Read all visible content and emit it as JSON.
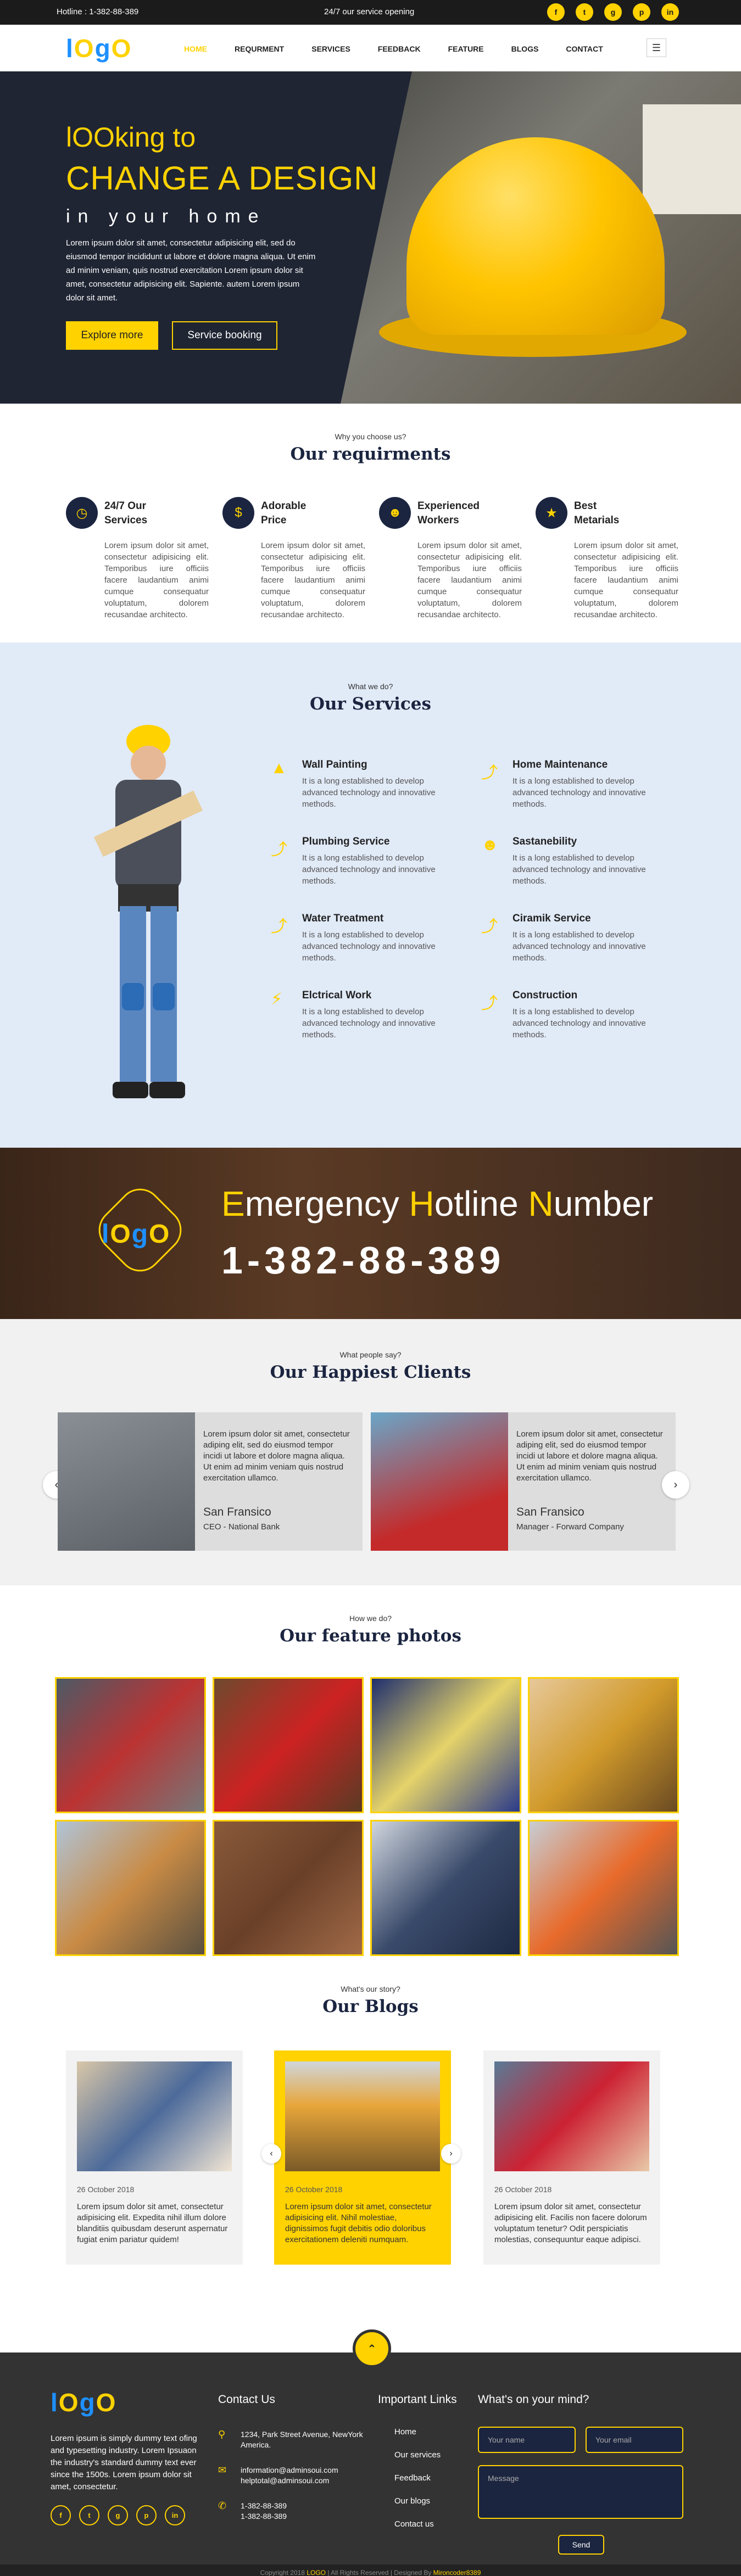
{
  "topbar": {
    "hotline": "Hotline : 1-382-88-389",
    "service": "24/7 our service opening",
    "social": [
      "f",
      "t",
      "g",
      "p",
      "in"
    ],
    "social_icons": [
      "facebook-icon",
      "twitter-icon",
      "instagram-icon",
      "pinterest-icon",
      "linkedin-icon"
    ]
  },
  "brand": {
    "logo_1": "l",
    "logo_2": "O",
    "logo_3": "g",
    "logo_4": "O",
    "blue": "#1e90ff",
    "yellow": "#ffd200"
  },
  "nav": {
    "items": [
      "HOME",
      "REQURMENT",
      "SERVICES",
      "FEEDBACK",
      "FEATURE",
      "BLOGS",
      "CONTACT"
    ],
    "active": "HOME",
    "menu_icon": "hamburger-icon"
  },
  "hero": {
    "line1": "lOOking to",
    "line2": "CHANGE A DESIGN",
    "line3": "in your home",
    "text": "Lorem ipsum dolor sit amet, consectetur adipisicing elit, sed do eiusmod tempor incididunt ut labore et dolore magna aliqua. Ut enim ad minim veniam, quis nostrud exercitation Lorem ipsum dolor sit amet, consectetur adipisicing elit. Sapiente. autem Lorem ipsum dolor sit amet.",
    "btn_explore": "Explore more",
    "btn_booking": "Service booking"
  },
  "requirements": {
    "sub": "Why you choose us?",
    "title": "Our requirments",
    "items": [
      {
        "title": "24/7 Our Services",
        "icon": "clock-icon",
        "text": "Lorem ipsum dolor sit amet, consectetur adipisicing elit. Temporibus iure officiis facere laudantium animi cumque consequatur voluptatum, dolorem recusandae architecto."
      },
      {
        "title": "Adorable Price",
        "icon": "dollar-icon",
        "text": "Lorem ipsum dolor sit amet, consectetur adipisicing elit. Temporibus iure officiis facere laudantium animi cumque consequatur voluptatum, dolorem recusandae architecto."
      },
      {
        "title": "Experienced Workers",
        "icon": "workers-icon",
        "text": "Lorem ipsum dolor sit amet, consectetur adipisicing elit. Temporibus iure officiis facere laudantium animi cumque consequatur voluptatum, dolorem recusandae architecto."
      },
      {
        "title": "Best Metarials",
        "icon": "medal-icon",
        "text": "Lorem ipsum dolor sit amet, consectetur adipisicing elit. Temporibus iure officiis facere laudantium animi cumque consequatur voluptatum, dolorem recusandae architecto."
      }
    ]
  },
  "services": {
    "sub": "What we do?",
    "title": "Our Services",
    "items": [
      {
        "title": "Wall Painting",
        "icon": "paint-roller-icon",
        "text": "It is a long established to develop advanced technology and innovative methods."
      },
      {
        "title": "Home Maintenance",
        "icon": "wrench-icon",
        "text": "It is a long established to develop advanced technology and innovative methods."
      },
      {
        "title": "Plumbing Service",
        "icon": "wrench-icon",
        "text": "It is a long established to develop advanced technology and innovative methods."
      },
      {
        "title": "Sastanebility",
        "icon": "people-icon",
        "text": "It is a long established to develop advanced technology and innovative methods."
      },
      {
        "title": "Water Treatment",
        "icon": "wrench-icon",
        "text": "It is a long established to develop advanced technology and innovative methods."
      },
      {
        "title": "Ciramik Service",
        "icon": "wrench-icon",
        "text": "It is a long established to develop advanced technology and innovative methods."
      },
      {
        "title": "Elctrical Work",
        "icon": "plug-icon",
        "text": "It is a long established to develop advanced technology and innovative methods."
      },
      {
        "title": "Construction",
        "icon": "wrench-icon",
        "text": "It is a long established to develop advanced technology and innovative methods."
      }
    ]
  },
  "hotline": {
    "w1a": "E",
    "w1b": "mergency ",
    "w2a": "H",
    "w2b": "otline ",
    "w3a": "N",
    "w3b": "umber",
    "number": "1-382-88-389"
  },
  "clients": {
    "sub": "What people say?",
    "title": "Our Happiest Clients",
    "items": [
      {
        "quote": "Lorem ipsum dolor sit amet, consectetur adiping elit, sed do eiusmod tempor incidi ut labore et dolore magna aliqua. Ut enim ad minim veniam quis nostrud exercitation ullamco.",
        "name": "San Fransico",
        "role": "CEO - National Bank"
      },
      {
        "quote": "Lorem ipsum dolor sit amet, consectetur adiping elit, sed do eiusmod tempor incidi ut labore et dolore magna aliqua. Ut enim ad minim veniam quis nostrud exercitation ullamco.",
        "name": "San Fransico",
        "role": "Manager - Forward Company"
      }
    ]
  },
  "features": {
    "sub": "How we do?",
    "title": "Our feature photos"
  },
  "blogs": {
    "sub": "What's our story?",
    "title": "Our Blogs",
    "items": [
      {
        "date": "26 October 2018",
        "text": "Lorem ipsum dolor sit amet, consectetur adipisicing elit. Expedita nihil illum dolore blanditiis quibusdam deserunt aspernatur fugiat enim pariatur quidem!"
      },
      {
        "date": "26 October 2018",
        "text": "Lorem ipsum dolor sit amet, consectetur adipisicing elit. Nihil molestiae, dignissimos fugit debitis odio doloribus exercitationem deleniti numquam."
      },
      {
        "date": "26 October 2018",
        "text": "Lorem ipsum dolor sit amet, consectetur adipisicing elit. Facilis non facere dolorum voluptatum tenetur? Odit perspiciatis molestias, consequuntur eaque adipisci."
      }
    ]
  },
  "footer": {
    "about": "Lorem ipsum is simply dummy text ofing and typesetting industry. Lorem Ipsuaon the industry's standard dummy text ever since the 1500s. Lorem ipsum dolor sit amet, consectetur.",
    "social": [
      "f",
      "t",
      "g",
      "p",
      "in"
    ],
    "contact_title": "Contact Us",
    "address": "1234, Park Street Avenue, NewYork America.",
    "email1": "information@adminsoui.com",
    "email2": "helptotal@adminsoui.com",
    "phone1": "1-382-88-389",
    "phone2": "1-382-88-389",
    "links_title": "Important Links",
    "links": [
      "Home",
      "Our services",
      "Feedback",
      "Our blogs",
      "Contact us"
    ],
    "mind_title": "What's on your mind?",
    "name_ph": "Your name",
    "email_ph": "Your email",
    "msg_ph": "Message",
    "send": "Send",
    "copy_a": "Copyright 2018 ",
    "copy_logo": "LOGO",
    "copy_b": "   |   All Rights Reserved   |   Designed By ",
    "copy_author": "Mironcoder8389"
  }
}
